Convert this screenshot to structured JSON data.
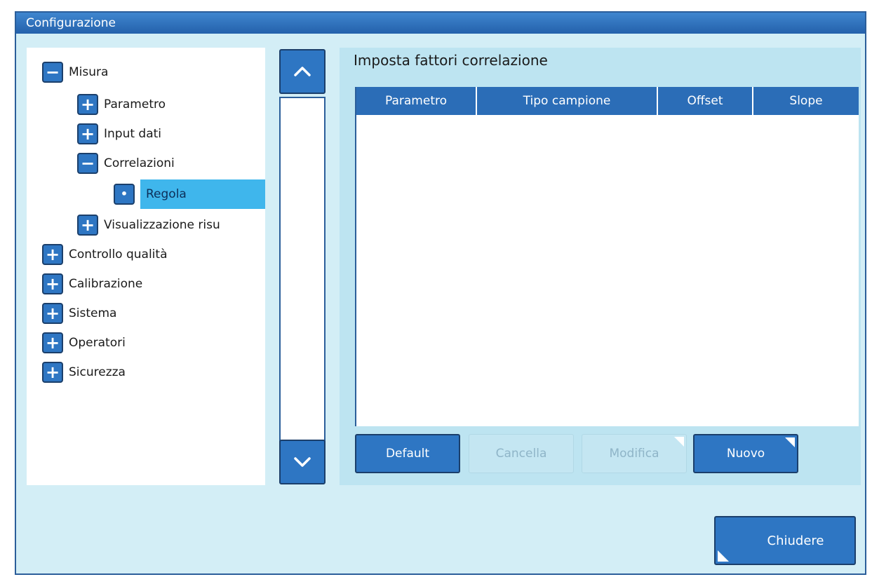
{
  "window": {
    "title": "Configurazione"
  },
  "tree": {
    "items": [
      {
        "label": "Misura",
        "state": "collapse"
      },
      {
        "label": "Parametro",
        "state": "expand"
      },
      {
        "label": "Input dati",
        "state": "expand"
      },
      {
        "label": "Correlazioni",
        "state": "collapse"
      },
      {
        "label": "Regola",
        "state": "leaf",
        "selected": true
      },
      {
        "label": "Visualizzazione risu",
        "state": "expand"
      },
      {
        "label": "Controllo qualità",
        "state": "expand"
      },
      {
        "label": "Calibrazione",
        "state": "expand"
      },
      {
        "label": "Sistema",
        "state": "expand"
      },
      {
        "label": "Operatori",
        "state": "expand"
      },
      {
        "label": "Sicurezza",
        "state": "expand"
      }
    ]
  },
  "panel": {
    "title": "Imposta fattori correlazione",
    "table": {
      "columns": [
        "Parametro",
        "Tipo campione",
        "Offset",
        "Slope"
      ],
      "rows": []
    }
  },
  "actions": {
    "default_label": "Default",
    "delete_label": "Cancella",
    "edit_label": "Modifica",
    "new_label": "Nuovo"
  },
  "footer": {
    "close_label": "Chiudere"
  },
  "colors": {
    "accent": "#2e76c3",
    "selection": "#3fb6ec",
    "background": "#d3eef6"
  }
}
